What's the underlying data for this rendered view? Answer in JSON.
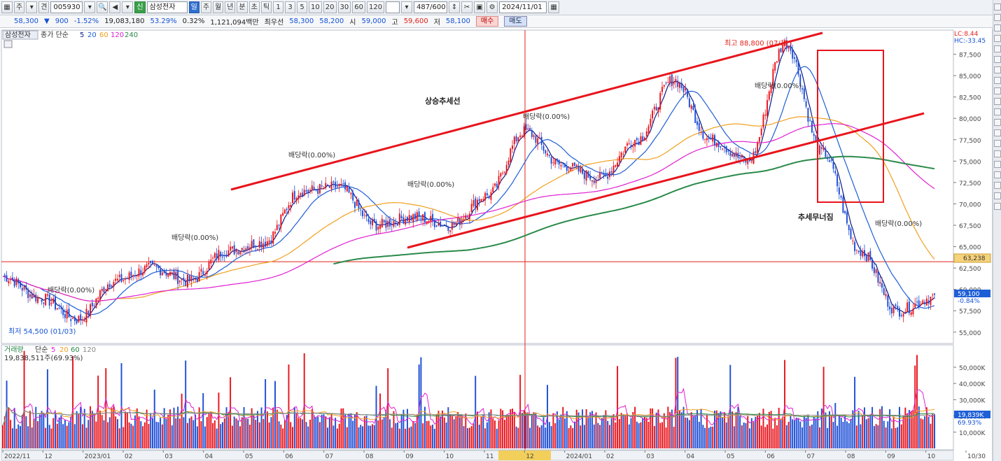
{
  "toolbar": {
    "type_label": "주",
    "code_prefix": "견",
    "code": "005930",
    "name": "삼성전자",
    "period_tabs": [
      "일",
      "주",
      "월",
      "년",
      "분",
      "초",
      "틱"
    ],
    "active_period": "일",
    "intervals": [
      "1",
      "3",
      "5",
      "10",
      "20",
      "30",
      "60",
      "120"
    ],
    "count": "487/600",
    "date": "2024/11/01"
  },
  "quote": {
    "price": "58,300",
    "change": "900",
    "change_pct": "-1.52%",
    "volume": "19,083,180",
    "turnover_pct": "53.29%",
    "ratio": "0.32%",
    "amount": "1,121,094백만",
    "best_ask_label": "최우선",
    "best_ask": "58,300",
    "best_bid": "58,200",
    "open_label": "시",
    "open": "59,000",
    "high_label": "고",
    "high": "59,600",
    "low_label": "저",
    "low": "58,100",
    "buy_label": "매수",
    "sell_label": "매도"
  },
  "price_panel": {
    "name": "삼성전자",
    "legend_prefix": "종가 단순",
    "ma_periods": [
      "5",
      "20",
      "60",
      "120",
      "240"
    ],
    "ma_colors": [
      "#0a1a8a",
      "#1e5fd6",
      "#f0a020",
      "#e020d0",
      "#2a8a4a"
    ],
    "corner_lc": "LC:8.44",
    "corner_hc": "HC:-33.45",
    "last_price_tag": "59,100",
    "last_change_tag": "-0.84%",
    "hline_tag": "63,238",
    "annotations": {
      "trend_up": "상승추세선",
      "trend_break": "추세무너짐",
      "high_label": "최고 88,800 (07/11)",
      "low_label": "최저 54,500 (01/03)",
      "dividends": [
        "배당락(0.00%)",
        "배당락(0.00%)",
        "배당락(0.00%)",
        "배당락(0.00%)",
        "배당락(0.00%)",
        "배당락(0.00%)",
        "배당락(0.00%)"
      ]
    }
  },
  "volume_panel": {
    "legend_title": "거래량",
    "legend_prefix": "단순",
    "ma_periods": [
      "5",
      "20",
      "60",
      "120"
    ],
    "ma_colors": [
      "#e020d0",
      "#f0a020",
      "#2a8a4a",
      "#888888"
    ],
    "current": "19,838,511주(69.93%)",
    "last_tag": "19,839K",
    "last_pct_tag": "69.93%"
  },
  "chart_data": {
    "type": "candlestick",
    "title": "삼성전자",
    "price_ylim": [
      54000,
      90000
    ],
    "price_ticks": [
      55000,
      57500,
      60000,
      62500,
      65000,
      67500,
      70000,
      72500,
      75000,
      77500,
      80000,
      82500,
      85000,
      87500
    ],
    "volume_ticks_k": [
      10000,
      20000,
      30000,
      40000,
      50000
    ],
    "volume_ylim_k": [
      0,
      56000
    ],
    "x_ticks": [
      "2022/11",
      "12",
      "2023/01",
      "02",
      "03",
      "04",
      "05",
      "06",
      "07",
      "08",
      "09",
      "10",
      "11",
      "12",
      "2024/01",
      "02",
      "03",
      "04",
      "05",
      "06",
      "07",
      "08",
      "09",
      "10",
      "10/30"
    ],
    "close_series": [
      {
        "date": "2022-11",
        "close": 61500
      },
      {
        "date": "2022-12",
        "close": 59000
      },
      {
        "date": "2023-01",
        "close": 56500
      },
      {
        "date": "2023-01",
        "close": 61000
      },
      {
        "date": "2023-02",
        "close": 62500
      },
      {
        "date": "2023-03",
        "close": 61000
      },
      {
        "date": "2023-04",
        "close": 64500
      },
      {
        "date": "2023-05",
        "close": 65500
      },
      {
        "date": "2023-06",
        "close": 71500
      },
      {
        "date": "2023-07",
        "close": 72000
      },
      {
        "date": "2023-08",
        "close": 67500
      },
      {
        "date": "2023-09",
        "close": 68500
      },
      {
        "date": "2023-10",
        "close": 67500
      },
      {
        "date": "2023-11",
        "close": 71000
      },
      {
        "date": "2023-12",
        "close": 78500
      },
      {
        "date": "2024-01",
        "close": 74500
      },
      {
        "date": "2024-02",
        "close": 73000
      },
      {
        "date": "2024-03",
        "close": 77500
      },
      {
        "date": "2024-04",
        "close": 84500
      },
      {
        "date": "2024-05",
        "close": 77500
      },
      {
        "date": "2024-06",
        "close": 75000
      },
      {
        "date": "2024-07",
        "close": 88800
      },
      {
        "date": "2024-08",
        "close": 76000
      },
      {
        "date": "2024-09",
        "close": 64500
      },
      {
        "date": "2024-10",
        "close": 57500
      },
      {
        "date": "2024-10-30",
        "close": 59100
      }
    ],
    "hline": 63238
  }
}
